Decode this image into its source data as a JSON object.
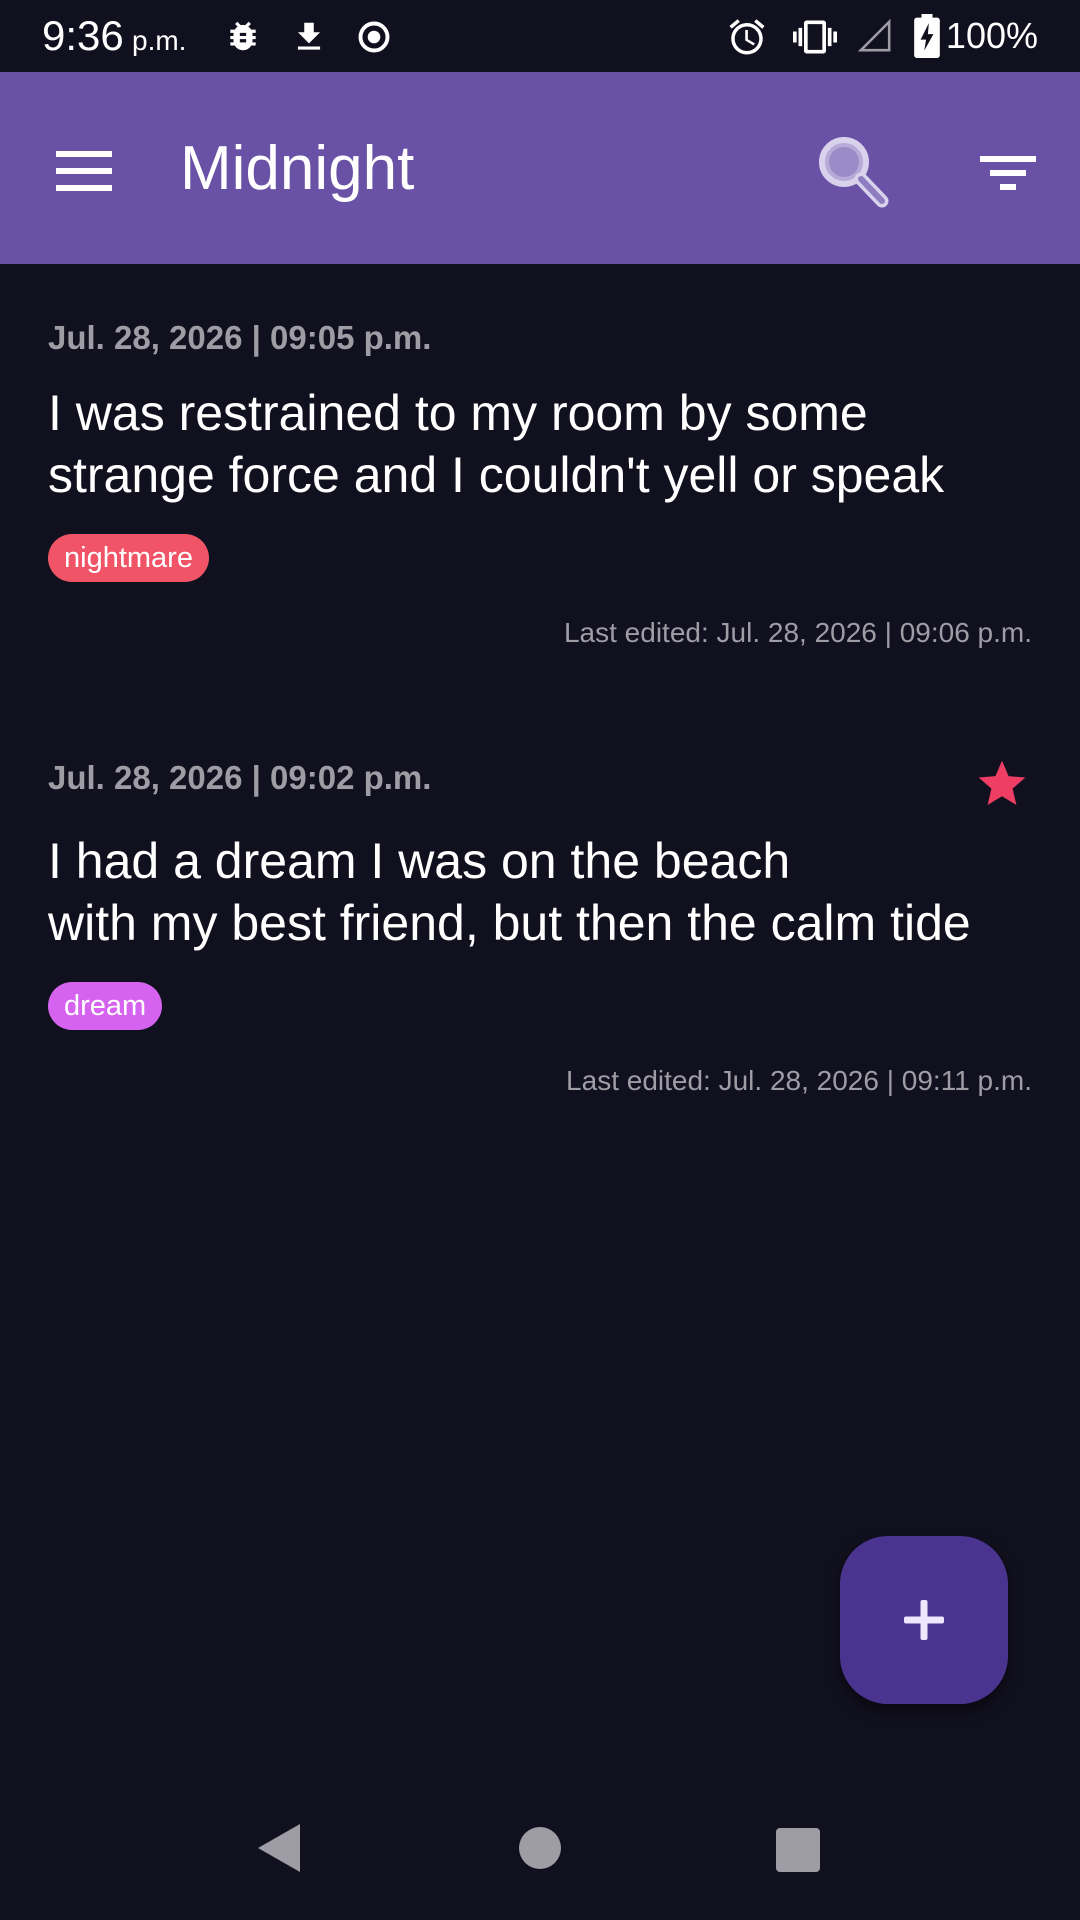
{
  "status_bar": {
    "time": "9:36",
    "ampm": "p.m.",
    "battery": "100%",
    "icons": [
      "bug-icon",
      "download-icon",
      "record-icon",
      "alarm-icon",
      "vibrate-icon",
      "signal-icon",
      "battery-charging-icon"
    ]
  },
  "app_bar": {
    "title": "Midnight",
    "color": "#6952a6",
    "icons": [
      "menu-icon",
      "search-icon",
      "filter-icon"
    ]
  },
  "entries": [
    {
      "date": "Jul. 28, 2026 | 09:05 p.m.",
      "text_lines": [
        "I was restrained to my room by some",
        "strange force and I couldn't yell or speak"
      ],
      "tag": "nightmare",
      "tag_color": "#f25467",
      "last_edited": "Last edited: Jul. 28, 2026 | 09:06 p.m.",
      "starred": false
    },
    {
      "date": "Jul. 28, 2026 | 09:02 p.m.",
      "text_lines": [
        "I had a dream I was on the beach",
        "with my best friend, but then the calm tide"
      ],
      "tag": "dream",
      "tag_color": "#d563f0",
      "last_edited": "Last edited: Jul. 28, 2026 | 09:11 p.m.",
      "starred": true,
      "star_color": "#ee3e63"
    }
  ],
  "fab": {
    "icon": "plus-icon",
    "color": "#4b3490"
  },
  "nav_bar": {
    "icons": [
      "back-icon",
      "home-icon",
      "recents-icon"
    ]
  }
}
